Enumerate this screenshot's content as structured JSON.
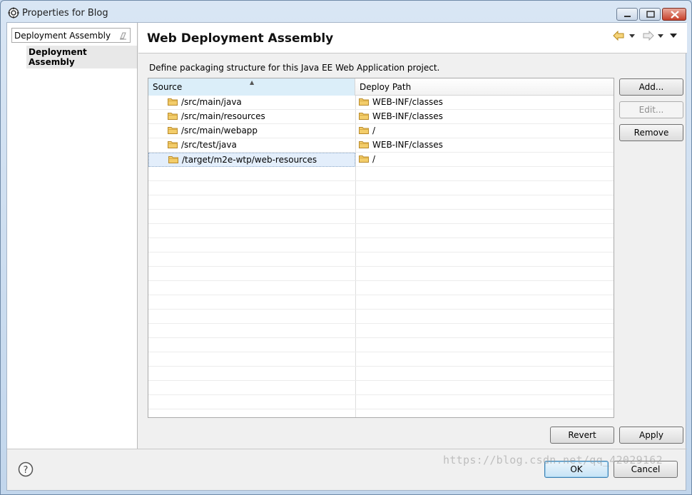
{
  "window": {
    "title": "Properties for Blog"
  },
  "left": {
    "filter_value": "Deployment Assembly",
    "tree_items": [
      {
        "label": "Deployment Assembly",
        "selected": true
      }
    ]
  },
  "page": {
    "title": "Web Deployment Assembly",
    "description": "Define packaging structure for this Java EE Web Application project."
  },
  "table": {
    "columns": [
      "Source",
      "Deploy Path"
    ],
    "rows": [
      {
        "source": "/src/main/java",
        "deploy": "WEB-INF/classes"
      },
      {
        "source": "/src/main/resources",
        "deploy": "WEB-INF/classes"
      },
      {
        "source": "/src/main/webapp",
        "deploy": "/"
      },
      {
        "source": "/src/test/java",
        "deploy": "WEB-INF/classes"
      },
      {
        "source": "/target/m2e-wtp/web-resources",
        "deploy": "/",
        "selected": true
      }
    ]
  },
  "buttons": {
    "add": "Add...",
    "edit": "Edit...",
    "remove": "Remove",
    "revert": "Revert",
    "apply": "Apply",
    "ok": "OK",
    "cancel": "Cancel"
  },
  "icons": {
    "app": "properties-icon",
    "folder": "folder-icon",
    "help": "help-icon",
    "back": "back-arrow-icon",
    "forward": "forward-arrow-icon"
  },
  "colors": {
    "folder": "#e8b84a",
    "selection": "#e3eefb",
    "header_sorted": "#dbeef9"
  },
  "watermark": "https://blog.csdn.net/qq_42029162"
}
